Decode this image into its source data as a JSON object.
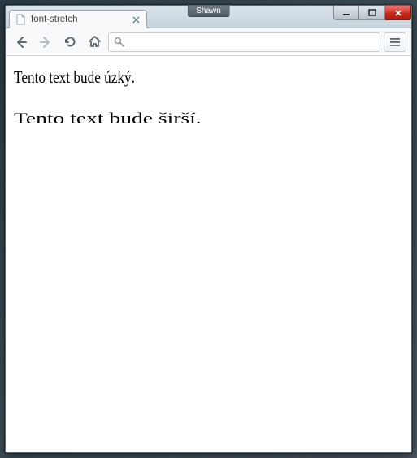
{
  "window": {
    "user_badge": "Shawn"
  },
  "tab": {
    "title": "font-stretch"
  },
  "omnibox": {
    "value": "",
    "placeholder": ""
  },
  "page": {
    "condensed_text": "Tento text bude úzký.",
    "expanded_text": "Tento text bude širší."
  }
}
